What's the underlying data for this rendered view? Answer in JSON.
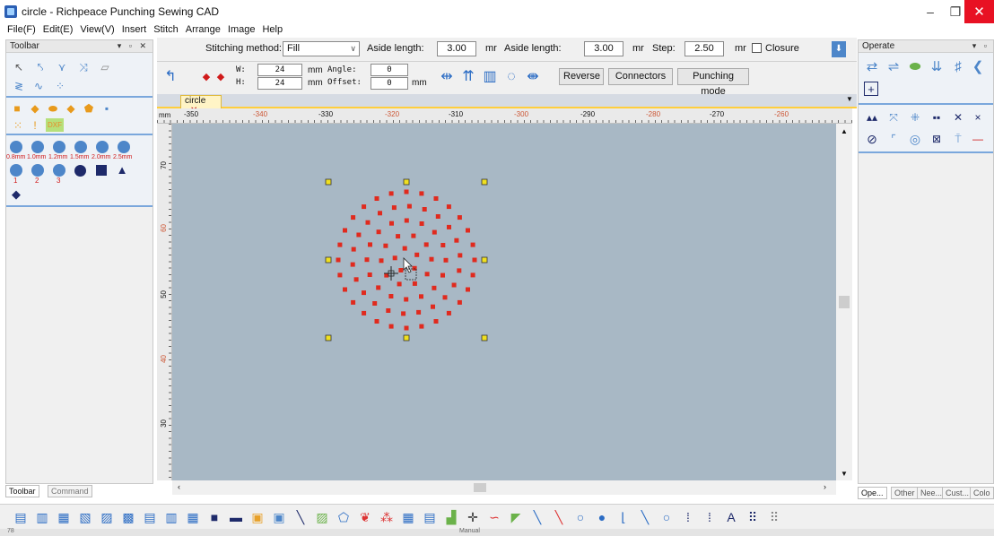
{
  "window": {
    "title": "circle - Richpeace Punching Sewing CAD",
    "controls": [
      "–",
      "❐",
      "✕"
    ]
  },
  "menu": [
    "File(F)",
    "Edit(E)",
    "View(V)",
    "Insert",
    "Stitch",
    "Arrange",
    "Image",
    "Help"
  ],
  "left_panel": {
    "title": "Toolbar",
    "size_labels": [
      "0.8mm",
      "1.0mm",
      "1.2mm",
      "1.5mm",
      "2.0mm",
      "2.5mm"
    ],
    "num_labels": [
      "1",
      "2",
      "3"
    ],
    "dxf_label": "DXF",
    "bottom_tabs": [
      "Toolbar",
      "Command"
    ]
  },
  "right_panel": {
    "title": "Operate",
    "bottom_tabs": [
      "Ope...",
      "Other",
      "Nee...",
      "Cust...",
      "Colo"
    ]
  },
  "options": {
    "stitching_method_label": "Stitching method:",
    "stitching_method_value": "Fill",
    "aside_label_1": "Aside length:",
    "aside_value_1": "3.00",
    "aside_unit_1": "mr",
    "aside_label_2": "Aside length:",
    "aside_value_2": "3.00",
    "aside_unit_2": "mr",
    "step_label": "Step:",
    "step_value": "2.50",
    "step_unit": "mr",
    "closure_label": "Closure",
    "w_label": "W:",
    "w_value": "24",
    "h_label": "H:",
    "h_value": "24",
    "mm_label": "mm",
    "angle_label": "Angle:",
    "angle_value": "0",
    "offset_label": "Offset:",
    "offset_value": "0",
    "reverse_label": "Reverse",
    "connectors_label": "Connectors",
    "punching_mode_label": "Punching mode"
  },
  "document": {
    "tab_name": "circle",
    "ruler_unit": "mm",
    "h_ticks": [
      "-350",
      "-340",
      "-330",
      "-320",
      "-310",
      "-300",
      "-290",
      "-280",
      "-270",
      "-260"
    ],
    "v_ticks": [
      "70",
      "60",
      "50",
      "40",
      "30"
    ]
  },
  "status": {
    "left": "78",
    "center": "Manual"
  },
  "colors": {
    "canvas": "#a8b8c5",
    "stitch_point": "#e02a1e",
    "handle": "#f0e020",
    "accent": "#7aa7dc"
  }
}
